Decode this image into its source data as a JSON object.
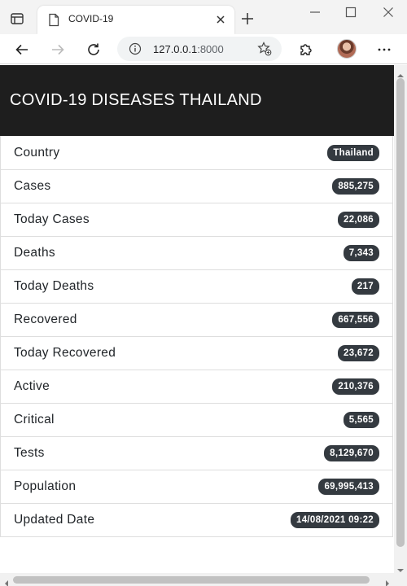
{
  "browser": {
    "tab_title": "COVID-19",
    "url_host": "127.0.0.1",
    "url_port": ":8000"
  },
  "page": {
    "title": "COVID-19 DISEASES THAILAND",
    "stats": [
      {
        "label": "Country",
        "value": "Thailand"
      },
      {
        "label": "Cases",
        "value": "885,275"
      },
      {
        "label": "Today Cases",
        "value": "22,086"
      },
      {
        "label": "Deaths",
        "value": "7,343"
      },
      {
        "label": "Today Deaths",
        "value": "217"
      },
      {
        "label": "Recovered",
        "value": "667,556"
      },
      {
        "label": "Today Recovered",
        "value": "23,672"
      },
      {
        "label": "Active",
        "value": "210,376"
      },
      {
        "label": "Critical",
        "value": "5,565"
      },
      {
        "label": "Tests",
        "value": "8,129,670"
      },
      {
        "label": "Population",
        "value": "69,995,413"
      },
      {
        "label": "Updated Date",
        "value": "14/08/2021 09:22"
      }
    ]
  },
  "colors": {
    "header_bg": "#1e1e1e",
    "badge_bg": "#343a40"
  }
}
